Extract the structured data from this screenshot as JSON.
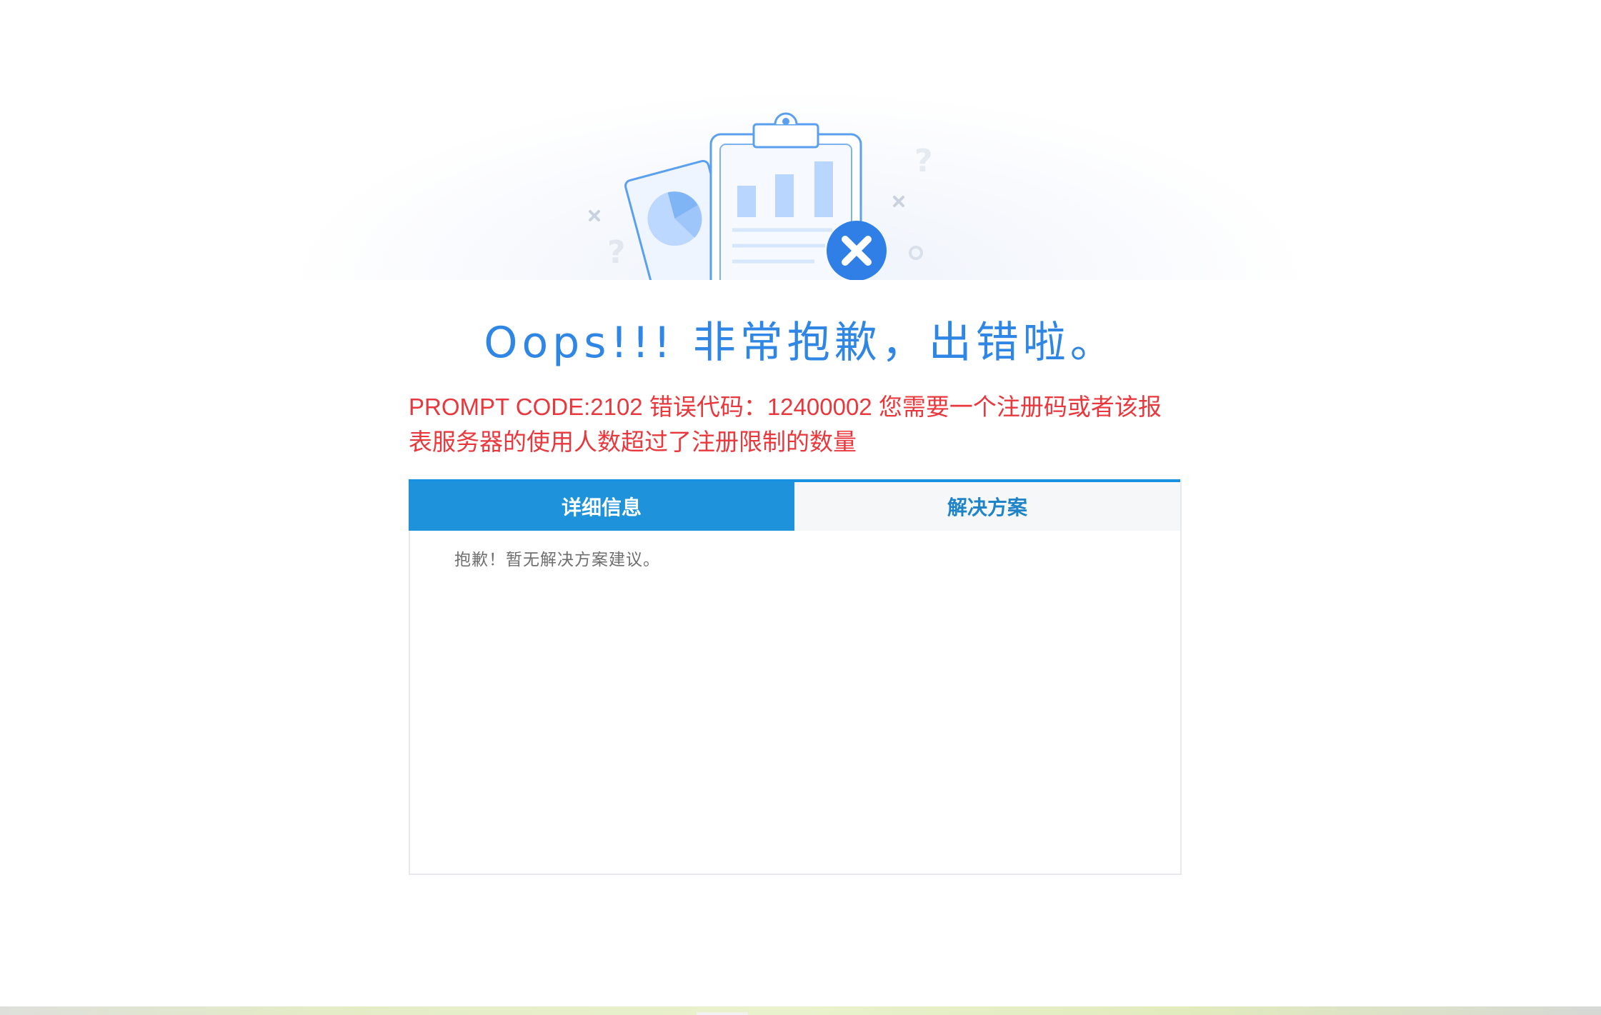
{
  "title": "Oops!!! 非常抱歉，出错啦。",
  "error_message": "PROMPT CODE:2102 错误代码：12400002 您需要一个注册码或者该报表服务器的使用人数超过了注册限制的数量",
  "tabs": [
    {
      "label": "详细信息",
      "active": true
    },
    {
      "label": "解决方案",
      "active": false
    }
  ],
  "panel_text": "抱歉！暂无解决方案建议。",
  "illustration": {
    "icons": [
      "clipboard-icon",
      "pie-chart-card-icon",
      "bar-chart-icon",
      "error-x-icon",
      "question-mark-icon",
      "small-x-icon",
      "small-circle-icon"
    ]
  },
  "colors": {
    "title": "#2f86e4",
    "error_text": "#e8383d",
    "tab_active_bg": "#1e93db",
    "tab_active_text": "#ffffff",
    "tab_inactive_bg": "#f5f7f9",
    "tab_inactive_text": "#1f83c8",
    "tab_border": "#1a90e0",
    "panel_text": "#6f6f6f"
  }
}
